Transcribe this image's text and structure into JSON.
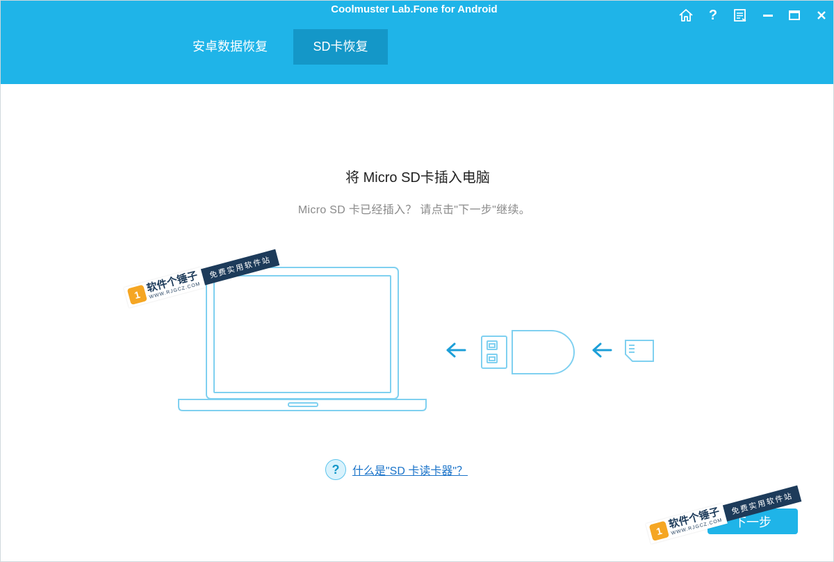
{
  "app": {
    "title": "Coolmuster Lab.Fone for Android"
  },
  "window_controls": [
    {
      "name": "home-icon",
      "label": "home"
    },
    {
      "name": "help-icon",
      "label": "help"
    },
    {
      "name": "feedback-icon",
      "label": "feedback"
    },
    {
      "name": "minimize-icon",
      "label": "minimize"
    },
    {
      "name": "maximize-icon",
      "label": "maximize"
    },
    {
      "name": "close-icon",
      "label": "close"
    }
  ],
  "tabs": [
    {
      "label": "安卓数据恢复",
      "active": false
    },
    {
      "label": "SD卡恢复",
      "active": true
    }
  ],
  "main": {
    "title": "将 Micro SD卡插入电脑",
    "subtitle": "Micro SD 卡已经插入？ 请点击\"下一步\"继续。",
    "help_link": "什么是\"SD 卡读卡器\"？",
    "help_icon": "?",
    "next_button": "下一步"
  },
  "watermark": {
    "name": "软件个锤子",
    "url": "WWW.RJGCZ.COM",
    "slogan": "免费实用软件站",
    "logo": "1"
  },
  "colors": {
    "accent": "#1fb4e8",
    "tab_active": "#1497c8",
    "illustration": "#7fd0f0",
    "link": "#1a73c9"
  }
}
